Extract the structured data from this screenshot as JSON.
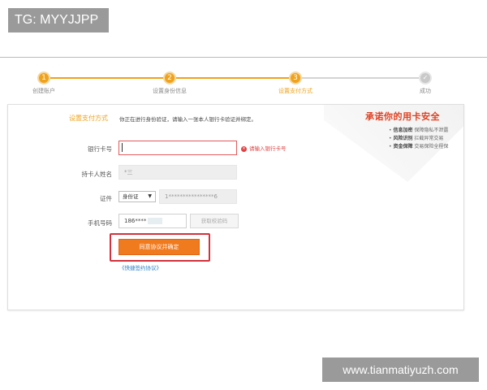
{
  "watermark_top": "TG: MYYJJPP",
  "watermark_bottom": "www.tianmatiyuzh.com",
  "steps": [
    {
      "number": "1",
      "label": "创建账户"
    },
    {
      "number": "2",
      "label": "设置身份信息"
    },
    {
      "number": "3",
      "label": "设置支付方式"
    },
    {
      "number": "✓",
      "label": "成功"
    }
  ],
  "colors": {
    "accent": "#f0a21b",
    "button": "#f07a1e",
    "highlight_frame": "#d2323c",
    "error": "#e04040",
    "link": "#2a7fc4"
  },
  "section": {
    "title": "设置支付方式",
    "tip": "你正在进行身份验证，请输入一张本人银行卡验证并绑定。"
  },
  "promise": {
    "title": "承诺你的用卡安全",
    "items": [
      {
        "strong": "信息加密",
        "text": "保障隐私不泄露"
      },
      {
        "strong": "风险识别",
        "text": "拦截异常交易"
      },
      {
        "strong": "资金保障",
        "text": "交易保险全程保"
      }
    ]
  },
  "form": {
    "card_number": {
      "label": "银行卡号",
      "value": "",
      "error": "请输入银行卡号"
    },
    "holder_name": {
      "label": "持卡人姓名",
      "value": "*三"
    },
    "id_doc": {
      "label": "证件",
      "type": "身份证",
      "value": "1****************6"
    },
    "phone": {
      "label": "手机号码",
      "value": "186****",
      "sms_button": "获取校验码"
    }
  },
  "agree_button": "同意协议并确定",
  "sign_link": "《快捷签约协议》"
}
